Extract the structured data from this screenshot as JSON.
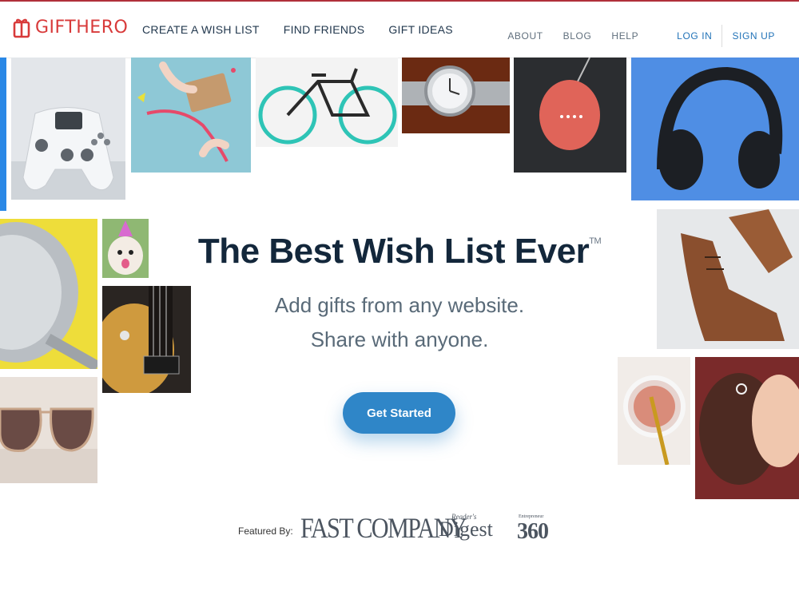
{
  "brand": {
    "name_gift": "GIFT",
    "name_hero": "HERO"
  },
  "nav": {
    "main": [
      "CREATE A WISH LIST",
      "FIND FRIENDS",
      "GIFT IDEAS"
    ],
    "secondary": [
      "ABOUT",
      "BLOG",
      "HELP"
    ],
    "login": "LOG IN",
    "signup": "SIGN UP"
  },
  "hero": {
    "title": "The Best Wish List Ever",
    "trademark": "TM",
    "line1": "Add gifts from any website.",
    "line2": "Share with anyone.",
    "cta": "Get Started"
  },
  "featured": {
    "label": "Featured By:",
    "fast_company": "FAST COMPANY",
    "readers": "Reader's",
    "digest": "Digest",
    "entrepreneur": "Entrepreneur",
    "e360": "360"
  },
  "colors": {
    "accent": "#2f86c8",
    "brand_red": "#d83a3a",
    "title": "#13273b"
  },
  "icons": [
    "gift-logo-icon"
  ]
}
